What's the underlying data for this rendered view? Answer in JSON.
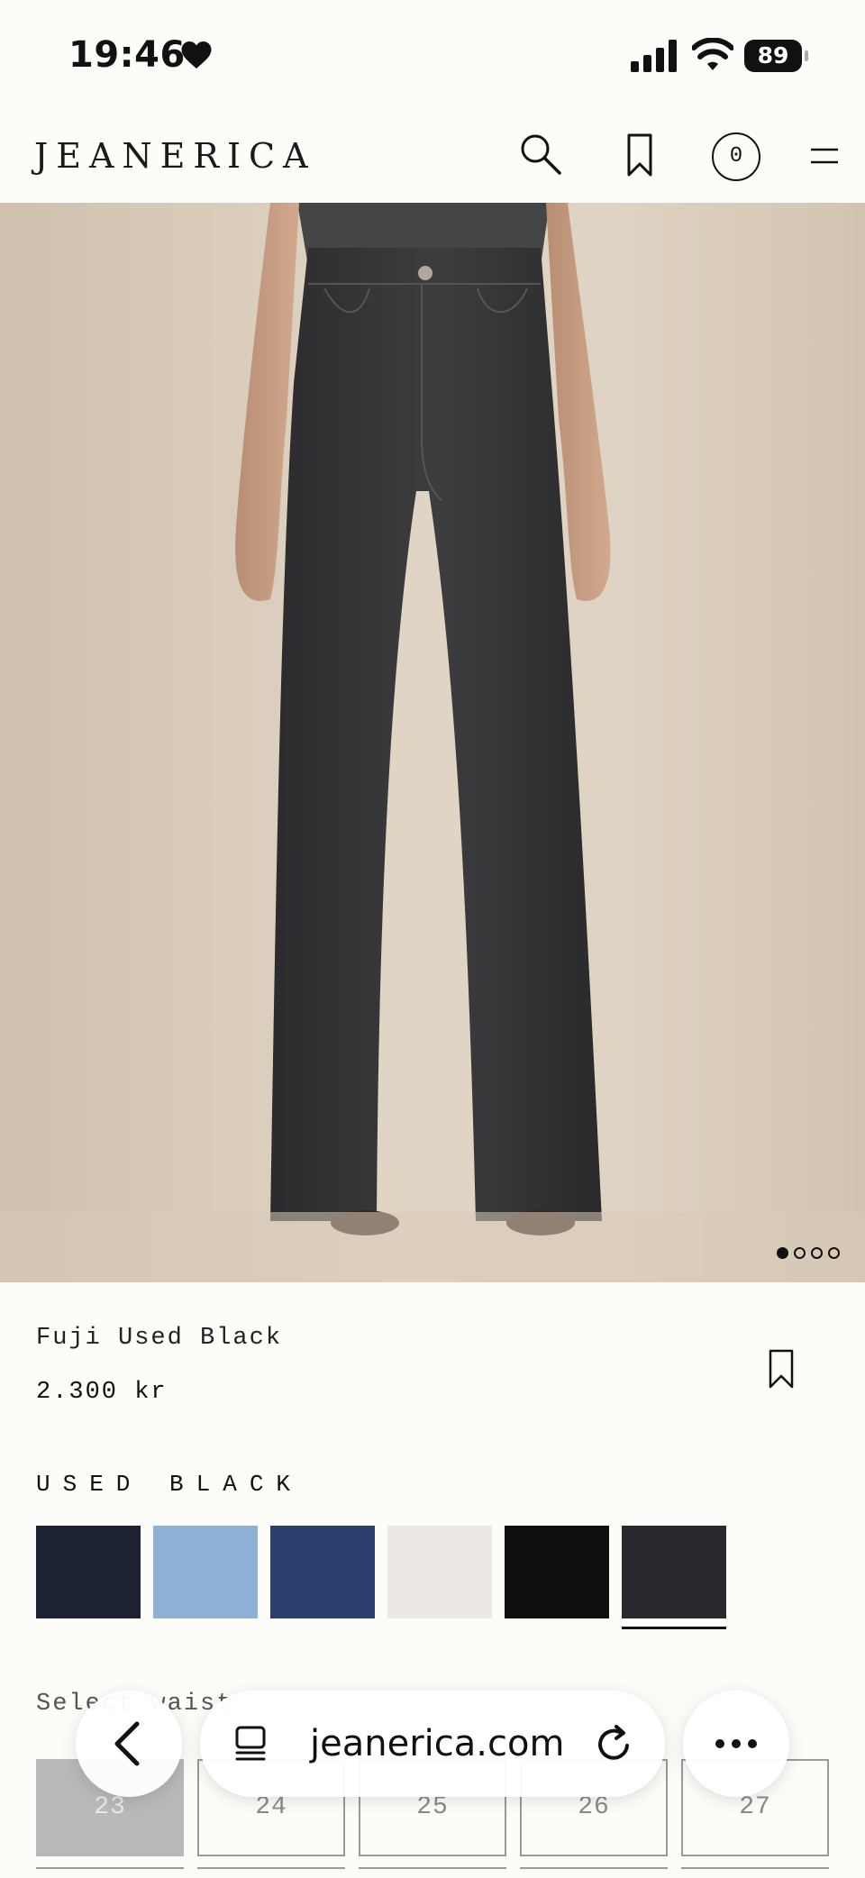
{
  "status_bar": {
    "time": "19:46",
    "battery": "89"
  },
  "header": {
    "brand": "JEANERICA",
    "cart_count": "0"
  },
  "carousel": {
    "current_slide": 1,
    "total_slides": 4
  },
  "product": {
    "name": "Fuji Used Black",
    "price": "2.300 kr",
    "color_name": "USED BLACK",
    "swatches": [
      {
        "color": "#1c2233"
      },
      {
        "color": "#8fb1d6"
      },
      {
        "color": "#2a3f6e"
      },
      {
        "color": "#ece9e5"
      },
      {
        "color": "#0f0f0f"
      },
      {
        "color": "#29282c",
        "selected": true
      }
    ],
    "selected_color_index": 5
  },
  "size_select": {
    "label": "Select waist",
    "sizes": [
      "23",
      "24",
      "25",
      "26",
      "27"
    ],
    "disabled_size_index": 0
  },
  "browser": {
    "url": "jeanerica.com"
  }
}
